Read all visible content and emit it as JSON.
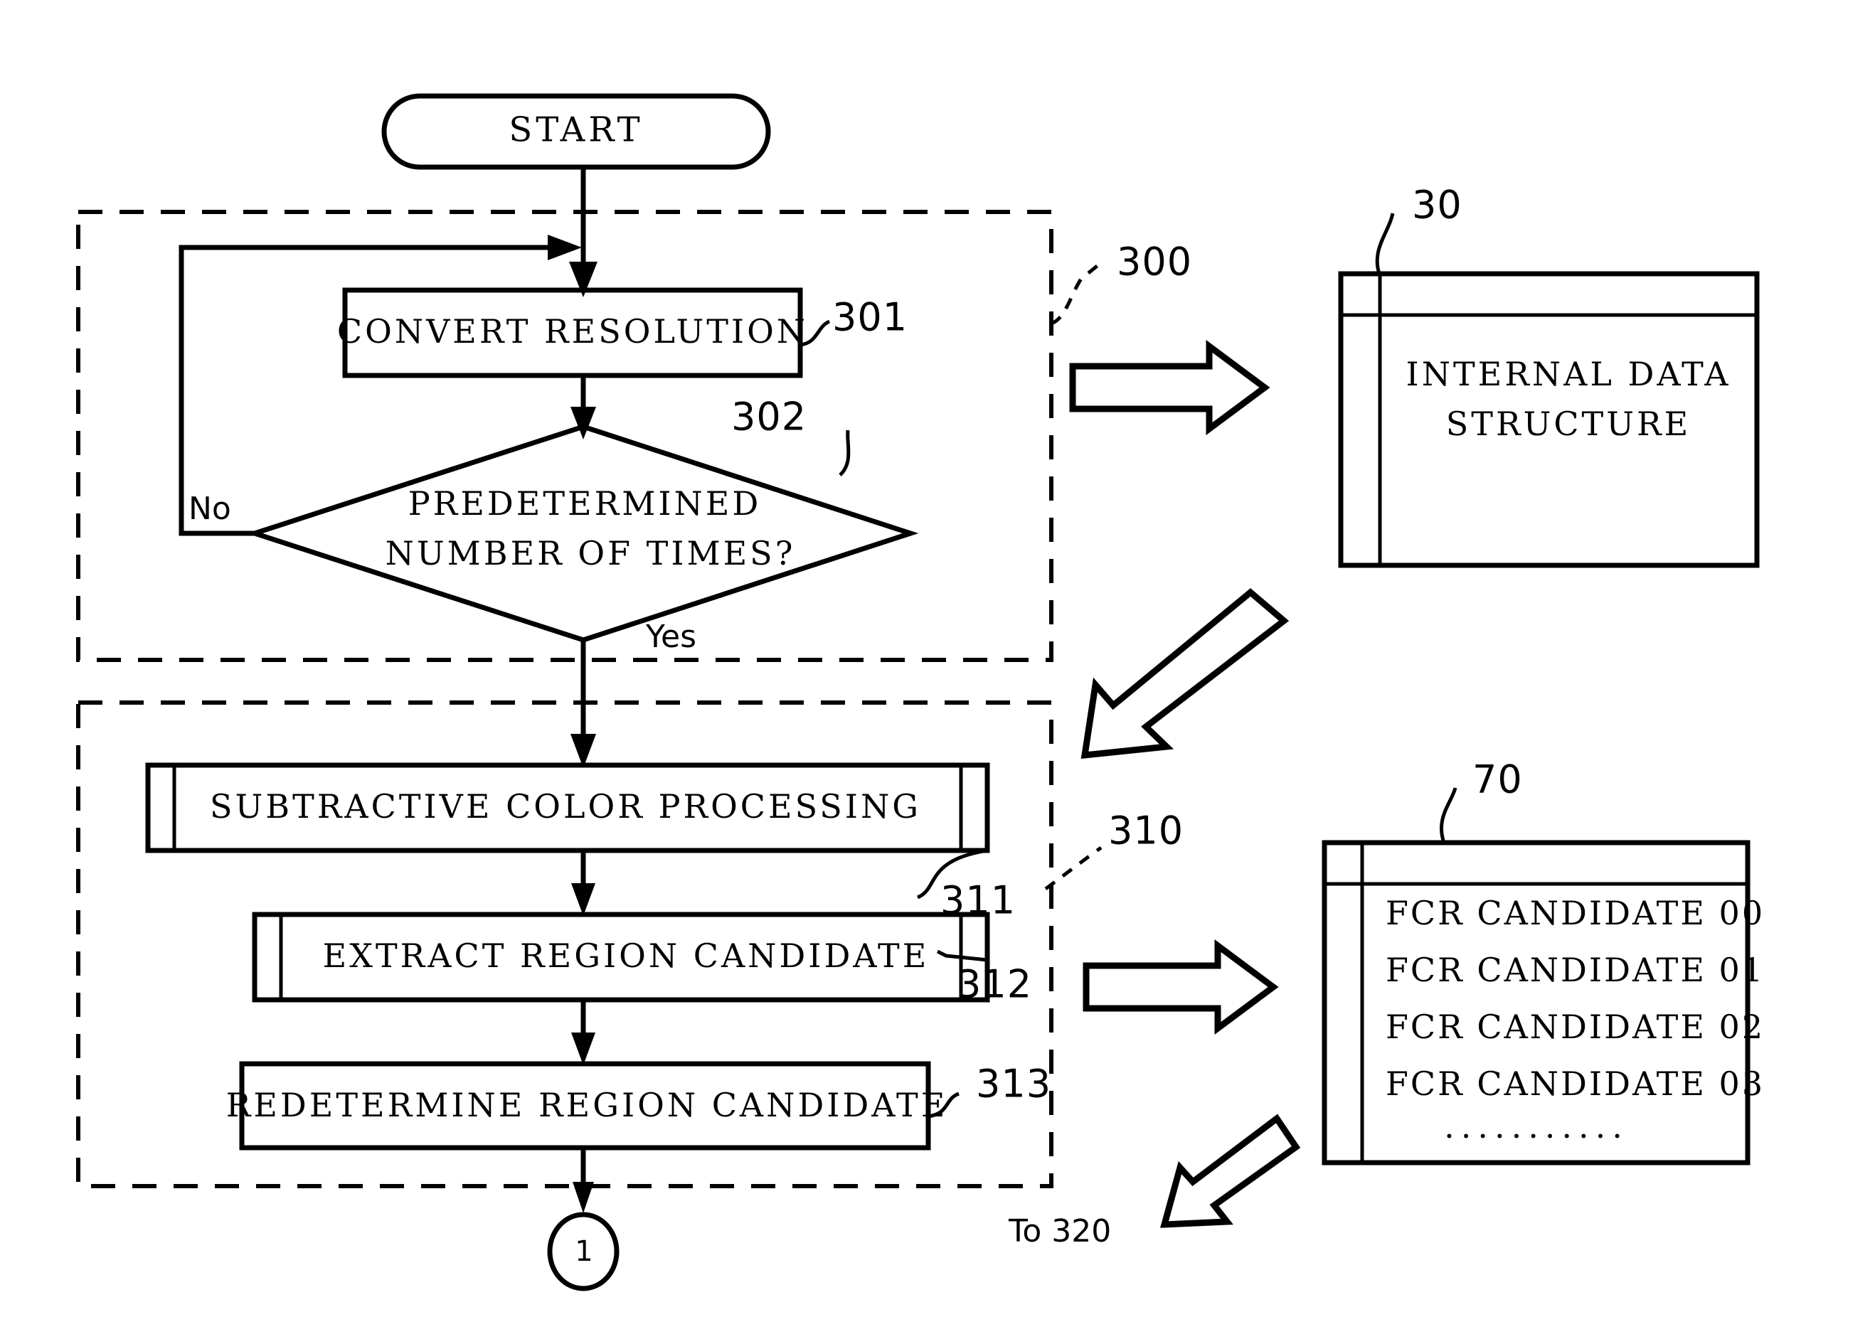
{
  "figure": {
    "kind": "patent-flowchart",
    "ink_color": "#000000",
    "background_color": "#ffffff"
  },
  "nodes": {
    "start": {
      "label": "START",
      "shape": "rounded-terminal"
    },
    "convert_resolution": {
      "label": "CONVERT RESOLUTION",
      "ref": "301",
      "shape": "process"
    },
    "decision": {
      "label_line1": "PREDETERMINED",
      "label_line2": "NUMBER OF TIMES?",
      "ref": "302",
      "shape": "decision"
    },
    "subtractive": {
      "label": "SUBTRACTIVE COLOR PROCESSING",
      "ref": "311",
      "shape": "predefined-process"
    },
    "extract": {
      "label": "EXTRACT REGION CANDIDATE",
      "ref": "312",
      "shape": "predefined-process"
    },
    "redetermine": {
      "label": "REDETERMINE REGION CANDIDATE",
      "ref": "313",
      "shape": "process"
    },
    "connector": {
      "label": "1",
      "shape": "circle-connector"
    }
  },
  "branches": {
    "no_label": "No",
    "yes_label": "Yes"
  },
  "groups": {
    "upper": {
      "ref": "300"
    },
    "lower": {
      "ref": "310"
    }
  },
  "data_objects": {
    "internal_data_structure": {
      "ref": "30",
      "line1": "INTERNAL DATA",
      "line2": "STRUCTURE"
    },
    "fcr_candidate_table": {
      "ref": "70",
      "rows": [
        "FCR CANDIDATE 00",
        "FCR CANDIDATE 01",
        "FCR CANDIDATE 02",
        "FCR CANDIDATE 03"
      ],
      "ellipsis": "..........."
    }
  },
  "annotations": {
    "to_320": "To 320"
  },
  "chart_data": {
    "type": "table",
    "title": "",
    "categories": [],
    "values": []
  }
}
